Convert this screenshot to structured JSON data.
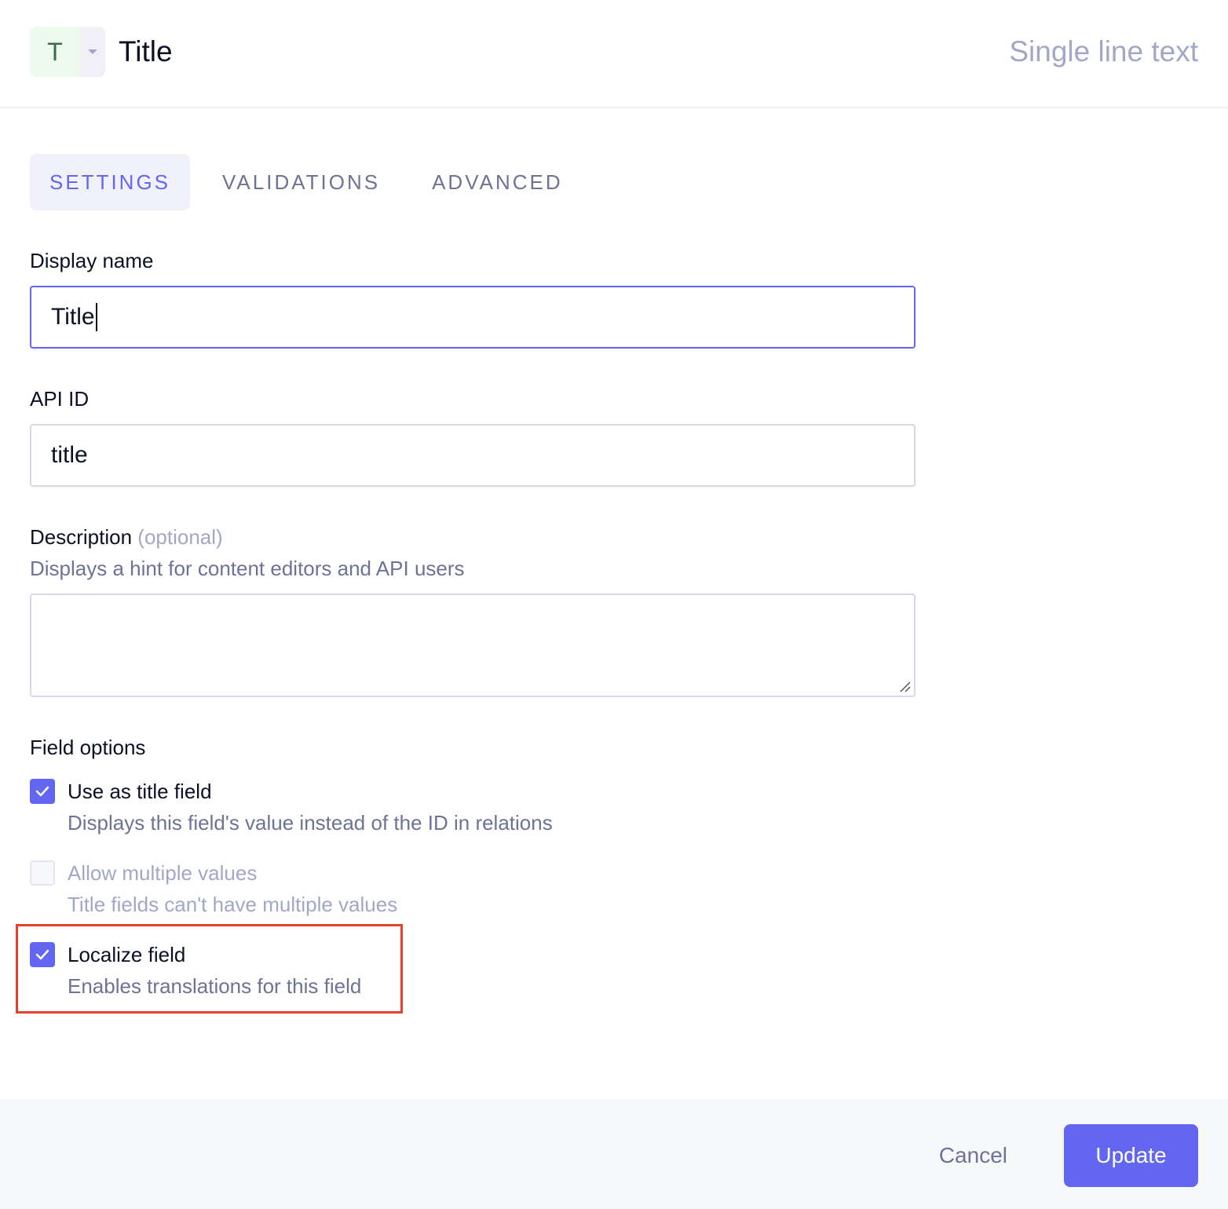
{
  "header": {
    "type_icon_letter": "T",
    "type_icon": "text-type-icon",
    "title": "Title",
    "field_type": "Single line text"
  },
  "tabs": [
    {
      "label": "SETTINGS",
      "active": true
    },
    {
      "label": "VALIDATIONS",
      "active": false
    },
    {
      "label": "ADVANCED",
      "active": false
    }
  ],
  "form": {
    "display_name": {
      "label": "Display name",
      "value": "Title"
    },
    "api_id": {
      "label": "API ID",
      "value": "title"
    },
    "description": {
      "label": "Description",
      "optional": "(optional)",
      "hint": "Displays a hint for content editors and API users",
      "value": ""
    }
  },
  "field_options": {
    "heading": "Field options",
    "items": [
      {
        "label": "Use as title field",
        "description": "Displays this field's value instead of the ID in relations",
        "checked": true,
        "disabled": false
      },
      {
        "label": "Allow multiple values",
        "description": "Title fields can't have multiple values",
        "checked": false,
        "disabled": true
      },
      {
        "label": "Localize field",
        "description": "Enables translations for this field",
        "checked": true,
        "disabled": false
      }
    ]
  },
  "footer": {
    "cancel_label": "Cancel",
    "update_label": "Update"
  },
  "colors": {
    "accent": "#6366f1",
    "highlight": "#e4432b"
  }
}
